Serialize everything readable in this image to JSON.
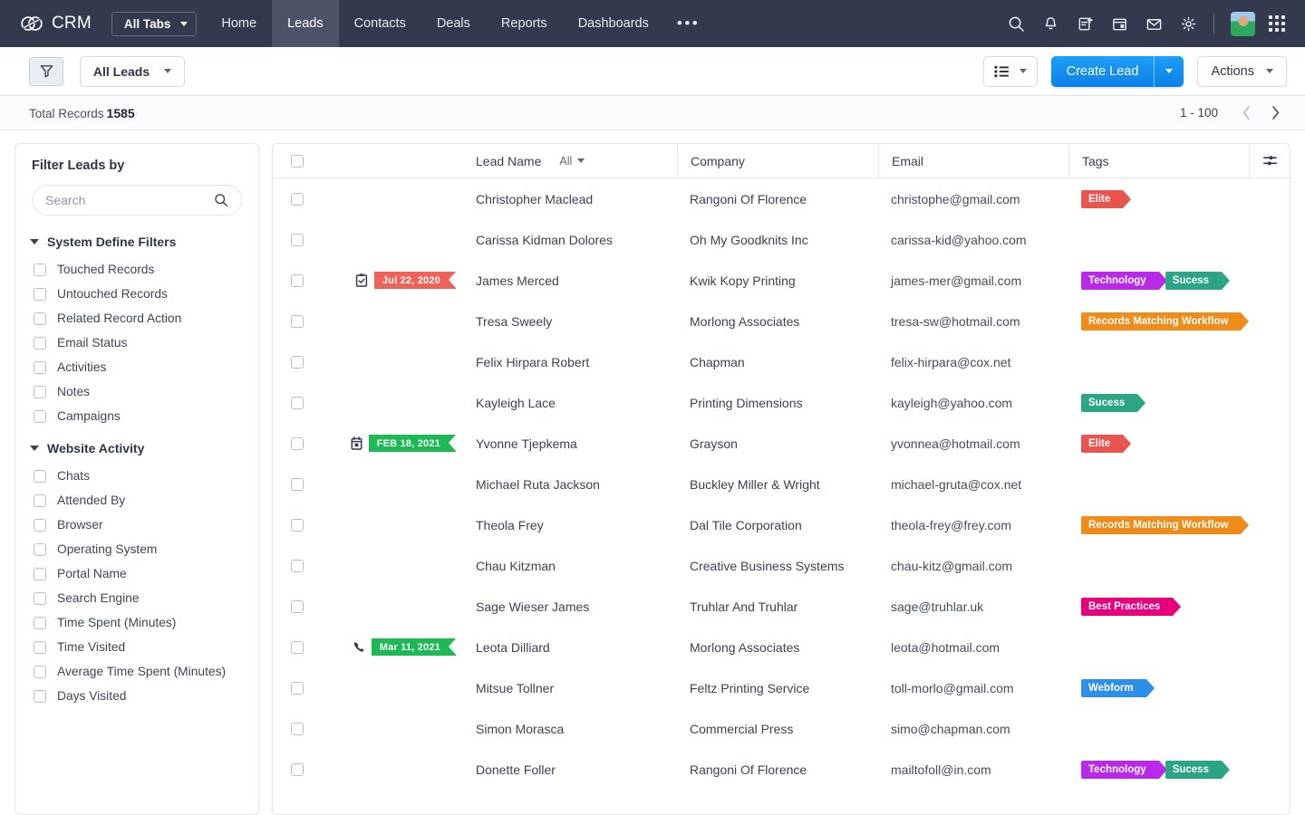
{
  "app": {
    "brand": "CRM",
    "all_tabs_label": "All Tabs",
    "nav_tabs": [
      {
        "label": "Home",
        "active": false
      },
      {
        "label": "Leads",
        "active": true
      },
      {
        "label": "Contacts",
        "active": false
      },
      {
        "label": "Deals",
        "active": false
      },
      {
        "label": "Reports",
        "active": false
      },
      {
        "label": "Dashboards",
        "active": false
      }
    ],
    "overflow_label": "•••",
    "header_icons": [
      "search-icon",
      "bell-icon",
      "add-note-icon",
      "calendar-icon",
      "mail-icon",
      "gear-icon"
    ]
  },
  "toolbar": {
    "filter_icon": "funnel-icon",
    "view_label": "All Leads",
    "list_view_icon": "list-view-icon",
    "create_label": "Create Lead",
    "actions_label": "Actions"
  },
  "records_bar": {
    "total_label": "Total Records",
    "total_count": "1585",
    "range": "1 - 100",
    "prev_icon": "chevron-left-icon",
    "next_icon": "chevron-right-icon"
  },
  "sidebar": {
    "title": "Filter Leads by",
    "search_placeholder": "Search",
    "search_value": "",
    "search_icon": "search-icon",
    "sections": [
      {
        "title": "System Define Filters",
        "expanded": true,
        "items": [
          "Touched Records",
          "Untouched Records",
          "Related Record Action",
          "Email Status",
          "Activities",
          "Notes",
          "Campaigns"
        ]
      },
      {
        "title": "Website Activity",
        "expanded": true,
        "items": [
          "Chats",
          "Attended By",
          "Browser",
          "Operating System",
          "Portal Name",
          "Search Engine",
          "Time Spent (Minutes)",
          "Time Visited",
          "Average Time Spent (Minutes)",
          "Days Visited"
        ]
      }
    ]
  },
  "table": {
    "columns": [
      "Lead Name",
      "Company",
      "Email",
      "Tags"
    ],
    "name_filter_label": "All",
    "settings_icon": "column-settings-icon",
    "tag_colors": {
      "Elite": "#e8554e",
      "Technology": "#b829e8",
      "Sucess": "#2ba585",
      "Records Matching Workflow": "#f08c1a",
      "Best Practices": "#e6007e",
      "Webform": "#2e8fe8"
    },
    "rows": [
      {
        "name": "Christopher Maclead",
        "company": "Rangoni Of Florence",
        "email": "christophe@gmail.com",
        "badge": null,
        "tags": [
          "Elite"
        ]
      },
      {
        "name": "Carissa Kidman Dolores",
        "company": "Oh My Goodknits Inc",
        "email": "carissa-kid@yahoo.com",
        "badge": null,
        "tags": []
      },
      {
        "name": "James Merced",
        "company": "Kwik Kopy Printing",
        "email": "james-mer@gmail.com",
        "badge": {
          "text": "Jul 22, 2020",
          "color": "#ef6259",
          "icon": "task-icon"
        },
        "tags": [
          "Technology",
          "Sucess"
        ]
      },
      {
        "name": "Tresa Sweely",
        "company": "Morlong Associates",
        "email": "tresa-sw@hotmail.com",
        "badge": null,
        "tags": [
          "Records Matching Workflow"
        ]
      },
      {
        "name": "Felix Hirpara Robert",
        "company": "Chapman",
        "email": "felix-hirpara@cox.net",
        "badge": null,
        "tags": []
      },
      {
        "name": "Kayleigh Lace",
        "company": "Printing Dimensions",
        "email": "kayleigh@yahoo.com",
        "badge": null,
        "tags": [
          "Sucess"
        ]
      },
      {
        "name": "Yvonne Tjepkema",
        "company": "Grayson",
        "email": "yvonnea@hotmail.com",
        "badge": {
          "text": "FEB 18, 2021",
          "color": "#1db954",
          "icon": "calendar-icon"
        },
        "tags": [
          "Elite"
        ]
      },
      {
        "name": "Michael Ruta Jackson",
        "company": "Buckley Miller & Wright",
        "email": "michael-gruta@cox.net",
        "badge": null,
        "tags": []
      },
      {
        "name": "Theola Frey",
        "company": "Dal Tile Corporation",
        "email": "theola-frey@frey.com",
        "badge": null,
        "tags": [
          "Records Matching Workflow"
        ]
      },
      {
        "name": "Chau Kitzman",
        "company": "Creative Business Systems",
        "email": "chau-kitz@gmail.com",
        "badge": null,
        "tags": []
      },
      {
        "name": "Sage Wieser James",
        "company": "Truhlar And Truhlar",
        "email": "sage@truhlar.uk",
        "badge": null,
        "tags": [
          "Best Practices"
        ]
      },
      {
        "name": "Leota Dilliard",
        "company": "Morlong Associates",
        "email": "leota@hotmail.com",
        "badge": {
          "text": "Mar 11, 2021",
          "color": "#1db954",
          "icon": "phone-icon"
        },
        "tags": []
      },
      {
        "name": "Mitsue Tollner",
        "company": "Feltz Printing Service",
        "email": "toll-morlo@gmail.com",
        "badge": null,
        "tags": [
          "Webform"
        ]
      },
      {
        "name": "Simon Morasca",
        "company": "Commercial Press",
        "email": "simo@chapman.com",
        "badge": null,
        "tags": []
      },
      {
        "name": "Donette Foller",
        "company": "Rangoni Of Florence",
        "email": "mailtofoll@in.com",
        "badge": null,
        "tags": [
          "Technology",
          "Sucess"
        ]
      }
    ]
  }
}
